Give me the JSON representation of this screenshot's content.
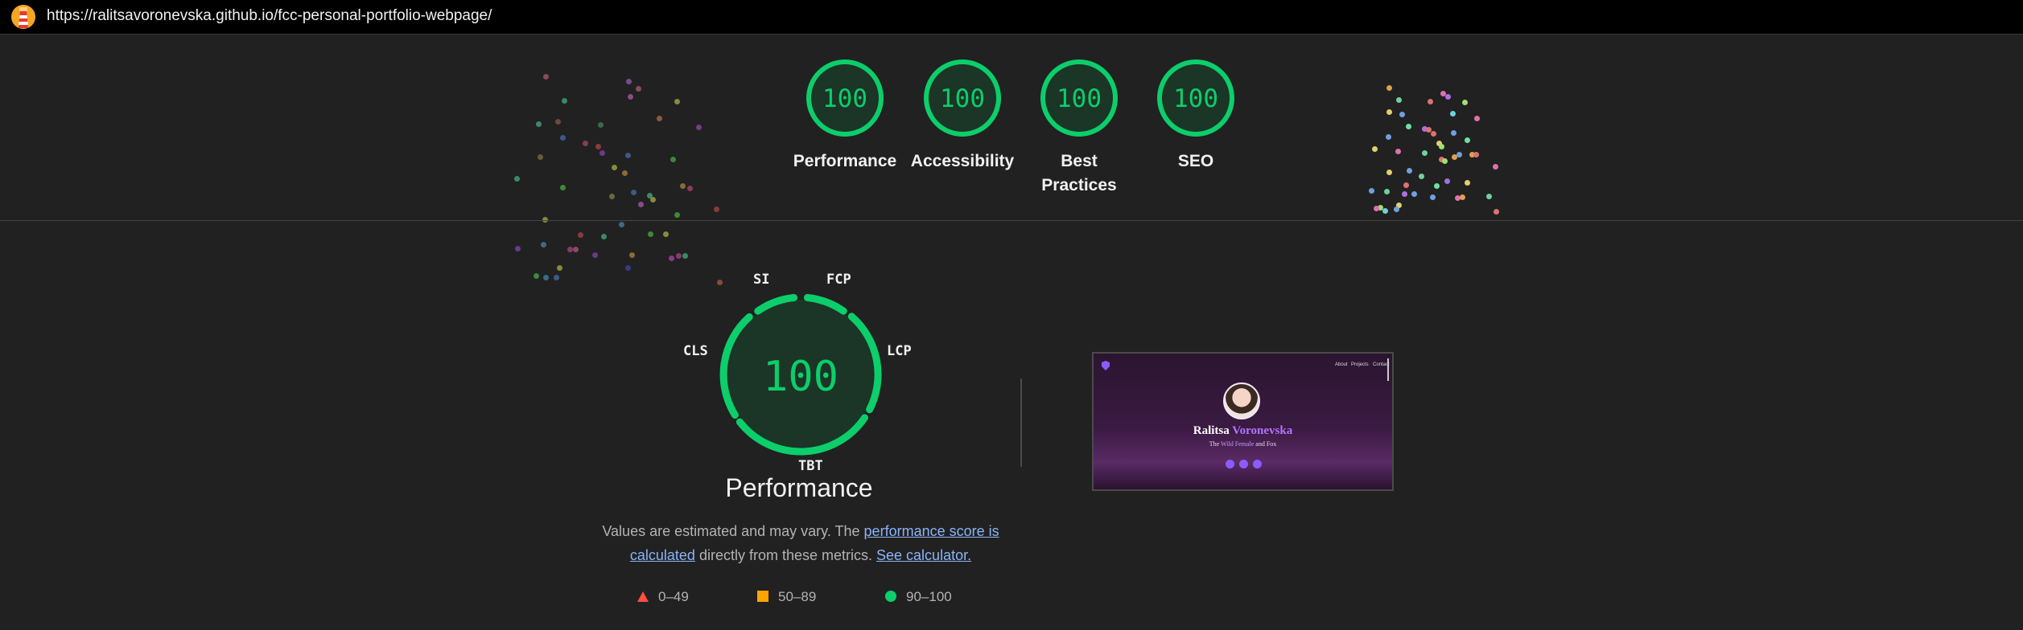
{
  "browser": {
    "url": "https://ralitsavoronevska.github.io/fcc-personal-portfolio-webpage/"
  },
  "colors": {
    "pass": "#0cce6b",
    "average": "#ffa400",
    "fail": "#ff4e42",
    "link": "#8ab4f8"
  },
  "category_scores": [
    {
      "label": "Performance",
      "score": "100"
    },
    {
      "label": "Accessibility",
      "score": "100"
    },
    {
      "label": "Best Practices",
      "score": "100"
    },
    {
      "label": "SEO",
      "score": "100"
    }
  ],
  "performance": {
    "score": "100",
    "title": "Performance",
    "metrics": [
      "SI",
      "FCP",
      "LCP",
      "TBT",
      "CLS"
    ],
    "description_prefix": "Values are estimated and may vary. The ",
    "score_link": "performance score is calculated",
    "description_middle": " directly from these metrics. ",
    "calculator_link": "See calculator."
  },
  "legend": [
    {
      "range": "0–49",
      "icon": "red-triangle-icon"
    },
    {
      "range": "50–89",
      "icon": "orange-square-icon"
    },
    {
      "range": "90–100",
      "icon": "green-circle-icon"
    }
  ],
  "screenshot_preview": {
    "nav_items": [
      "About",
      "Projects",
      "Contact"
    ],
    "name_first": "Ralitsa",
    "name_last": "Voronevska",
    "subtitle_prefix": "The",
    "subtitle_highlight": "Wild Female",
    "subtitle_suffix": "and Fox"
  }
}
